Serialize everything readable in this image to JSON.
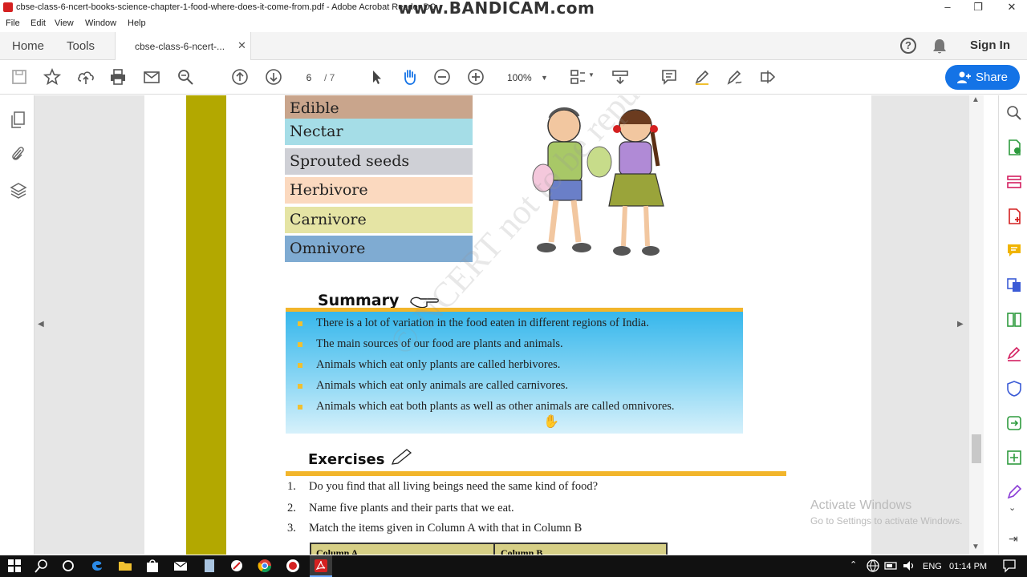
{
  "window": {
    "title": "cbse-class-6-ncert-books-science-chapter-1-food-where-does-it-come-from.pdf - Adobe Acrobat Reader DC",
    "watermark": "www.BANDICAM.com"
  },
  "menu": [
    "File",
    "Edit",
    "View",
    "Window",
    "Help"
  ],
  "tabs": {
    "home": "Home",
    "tools": "Tools",
    "document": "cbse-class-6-ncert-...",
    "sign_in": "Sign In"
  },
  "toolbar": {
    "page_current": "6",
    "page_total": "/ 7",
    "zoom": "100%",
    "share": "Share"
  },
  "document": {
    "key_words": [
      {
        "label": "Edible",
        "color": "#c9a58c"
      },
      {
        "label": "Nectar",
        "color": "#a5dde7"
      },
      {
        "label": "Sprouted seeds",
        "color": "#cfd0d6"
      },
      {
        "label": "Herbivore",
        "color": "#fbd9bf"
      },
      {
        "label": "Carnivore",
        "color": "#e5e4a4"
      },
      {
        "label": "Omnivore",
        "color": "#7fabd2"
      }
    ],
    "summary_title": "Summary",
    "summary": [
      "There is a lot of variation in the food eaten in different regions of India.",
      "The main sources of our food are plants and animals.",
      "Animals which eat only plants are called herbivores.",
      "Animals which eat only animals are called carnivores.",
      "Animals which eat both plants as well as other animals are called omnivores."
    ],
    "exercises_title": "Exercises",
    "exercises": [
      {
        "num": "1.",
        "text": "Do you find that all living beings need the same kind of food?"
      },
      {
        "num": "2.",
        "text": "Name five plants and their parts that we eat."
      },
      {
        "num": "3.",
        "text": "Match the items given in Column A with that in Column B"
      }
    ],
    "table_headers": [
      "Column A",
      "Column B"
    ],
    "watermark": "© NCERT not to be republished"
  },
  "os": {
    "activate_title": "Activate Windows",
    "activate_sub": "Go to Settings to activate Windows.",
    "lang": "ENG",
    "time": "01:14 PM"
  },
  "colors": {
    "accent": "#1473e6",
    "olive_bar": "#b3a800",
    "summary_rule": "#f2b52b"
  }
}
